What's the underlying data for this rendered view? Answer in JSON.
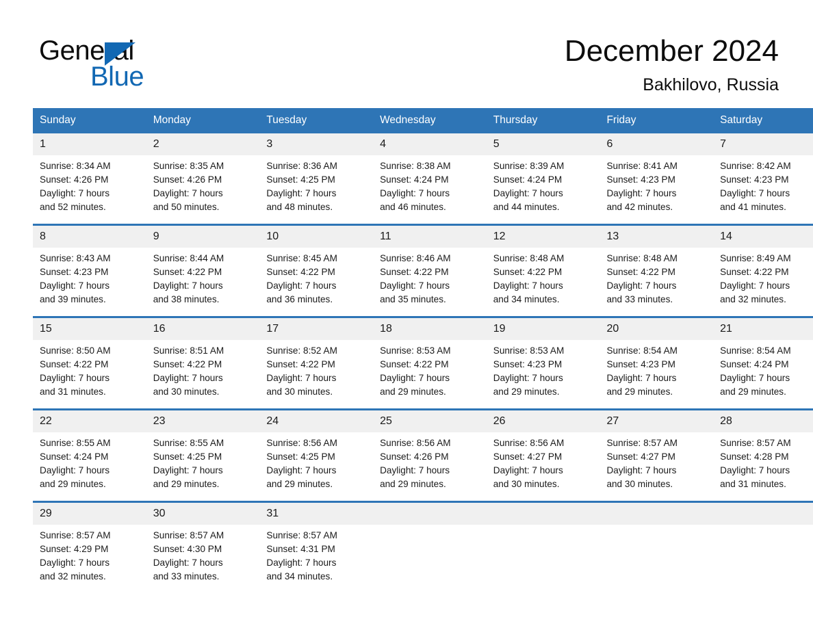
{
  "brand": {
    "name_part1": "General",
    "name_part2": "Blue",
    "accent_color": "#1268b3",
    "triangle_icon": "triangle-icon"
  },
  "header": {
    "month_title": "December 2024",
    "location": "Bakhilovo, Russia"
  },
  "theme": {
    "header_blue": "#2e75b6",
    "row_gray": "#f0f0f0",
    "text_black": "#1a1a1a"
  },
  "calendar": {
    "weekday_headers": [
      "Sunday",
      "Monday",
      "Tuesday",
      "Wednesday",
      "Thursday",
      "Friday",
      "Saturday"
    ],
    "weeks": [
      [
        {
          "day": "1",
          "sunrise": "Sunrise: 8:34 AM",
          "sunset": "Sunset: 4:26 PM",
          "daylight_line1": "Daylight: 7 hours",
          "daylight_line2": "and 52 minutes."
        },
        {
          "day": "2",
          "sunrise": "Sunrise: 8:35 AM",
          "sunset": "Sunset: 4:26 PM",
          "daylight_line1": "Daylight: 7 hours",
          "daylight_line2": "and 50 minutes."
        },
        {
          "day": "3",
          "sunrise": "Sunrise: 8:36 AM",
          "sunset": "Sunset: 4:25 PM",
          "daylight_line1": "Daylight: 7 hours",
          "daylight_line2": "and 48 minutes."
        },
        {
          "day": "4",
          "sunrise": "Sunrise: 8:38 AM",
          "sunset": "Sunset: 4:24 PM",
          "daylight_line1": "Daylight: 7 hours",
          "daylight_line2": "and 46 minutes."
        },
        {
          "day": "5",
          "sunrise": "Sunrise: 8:39 AM",
          "sunset": "Sunset: 4:24 PM",
          "daylight_line1": "Daylight: 7 hours",
          "daylight_line2": "and 44 minutes."
        },
        {
          "day": "6",
          "sunrise": "Sunrise: 8:41 AM",
          "sunset": "Sunset: 4:23 PM",
          "daylight_line1": "Daylight: 7 hours",
          "daylight_line2": "and 42 minutes."
        },
        {
          "day": "7",
          "sunrise": "Sunrise: 8:42 AM",
          "sunset": "Sunset: 4:23 PM",
          "daylight_line1": "Daylight: 7 hours",
          "daylight_line2": "and 41 minutes."
        }
      ],
      [
        {
          "day": "8",
          "sunrise": "Sunrise: 8:43 AM",
          "sunset": "Sunset: 4:23 PM",
          "daylight_line1": "Daylight: 7 hours",
          "daylight_line2": "and 39 minutes."
        },
        {
          "day": "9",
          "sunrise": "Sunrise: 8:44 AM",
          "sunset": "Sunset: 4:22 PM",
          "daylight_line1": "Daylight: 7 hours",
          "daylight_line2": "and 38 minutes."
        },
        {
          "day": "10",
          "sunrise": "Sunrise: 8:45 AM",
          "sunset": "Sunset: 4:22 PM",
          "daylight_line1": "Daylight: 7 hours",
          "daylight_line2": "and 36 minutes."
        },
        {
          "day": "11",
          "sunrise": "Sunrise: 8:46 AM",
          "sunset": "Sunset: 4:22 PM",
          "daylight_line1": "Daylight: 7 hours",
          "daylight_line2": "and 35 minutes."
        },
        {
          "day": "12",
          "sunrise": "Sunrise: 8:48 AM",
          "sunset": "Sunset: 4:22 PM",
          "daylight_line1": "Daylight: 7 hours",
          "daylight_line2": "and 34 minutes."
        },
        {
          "day": "13",
          "sunrise": "Sunrise: 8:48 AM",
          "sunset": "Sunset: 4:22 PM",
          "daylight_line1": "Daylight: 7 hours",
          "daylight_line2": "and 33 minutes."
        },
        {
          "day": "14",
          "sunrise": "Sunrise: 8:49 AM",
          "sunset": "Sunset: 4:22 PM",
          "daylight_line1": "Daylight: 7 hours",
          "daylight_line2": "and 32 minutes."
        }
      ],
      [
        {
          "day": "15",
          "sunrise": "Sunrise: 8:50 AM",
          "sunset": "Sunset: 4:22 PM",
          "daylight_line1": "Daylight: 7 hours",
          "daylight_line2": "and 31 minutes."
        },
        {
          "day": "16",
          "sunrise": "Sunrise: 8:51 AM",
          "sunset": "Sunset: 4:22 PM",
          "daylight_line1": "Daylight: 7 hours",
          "daylight_line2": "and 30 minutes."
        },
        {
          "day": "17",
          "sunrise": "Sunrise: 8:52 AM",
          "sunset": "Sunset: 4:22 PM",
          "daylight_line1": "Daylight: 7 hours",
          "daylight_line2": "and 30 minutes."
        },
        {
          "day": "18",
          "sunrise": "Sunrise: 8:53 AM",
          "sunset": "Sunset: 4:22 PM",
          "daylight_line1": "Daylight: 7 hours",
          "daylight_line2": "and 29 minutes."
        },
        {
          "day": "19",
          "sunrise": "Sunrise: 8:53 AM",
          "sunset": "Sunset: 4:23 PM",
          "daylight_line1": "Daylight: 7 hours",
          "daylight_line2": "and 29 minutes."
        },
        {
          "day": "20",
          "sunrise": "Sunrise: 8:54 AM",
          "sunset": "Sunset: 4:23 PM",
          "daylight_line1": "Daylight: 7 hours",
          "daylight_line2": "and 29 minutes."
        },
        {
          "day": "21",
          "sunrise": "Sunrise: 8:54 AM",
          "sunset": "Sunset: 4:24 PM",
          "daylight_line1": "Daylight: 7 hours",
          "daylight_line2": "and 29 minutes."
        }
      ],
      [
        {
          "day": "22",
          "sunrise": "Sunrise: 8:55 AM",
          "sunset": "Sunset: 4:24 PM",
          "daylight_line1": "Daylight: 7 hours",
          "daylight_line2": "and 29 minutes."
        },
        {
          "day": "23",
          "sunrise": "Sunrise: 8:55 AM",
          "sunset": "Sunset: 4:25 PM",
          "daylight_line1": "Daylight: 7 hours",
          "daylight_line2": "and 29 minutes."
        },
        {
          "day": "24",
          "sunrise": "Sunrise: 8:56 AM",
          "sunset": "Sunset: 4:25 PM",
          "daylight_line1": "Daylight: 7 hours",
          "daylight_line2": "and 29 minutes."
        },
        {
          "day": "25",
          "sunrise": "Sunrise: 8:56 AM",
          "sunset": "Sunset: 4:26 PM",
          "daylight_line1": "Daylight: 7 hours",
          "daylight_line2": "and 29 minutes."
        },
        {
          "day": "26",
          "sunrise": "Sunrise: 8:56 AM",
          "sunset": "Sunset: 4:27 PM",
          "daylight_line1": "Daylight: 7 hours",
          "daylight_line2": "and 30 minutes."
        },
        {
          "day": "27",
          "sunrise": "Sunrise: 8:57 AM",
          "sunset": "Sunset: 4:27 PM",
          "daylight_line1": "Daylight: 7 hours",
          "daylight_line2": "and 30 minutes."
        },
        {
          "day": "28",
          "sunrise": "Sunrise: 8:57 AM",
          "sunset": "Sunset: 4:28 PM",
          "daylight_line1": "Daylight: 7 hours",
          "daylight_line2": "and 31 minutes."
        }
      ],
      [
        {
          "day": "29",
          "sunrise": "Sunrise: 8:57 AM",
          "sunset": "Sunset: 4:29 PM",
          "daylight_line1": "Daylight: 7 hours",
          "daylight_line2": "and 32 minutes."
        },
        {
          "day": "30",
          "sunrise": "Sunrise: 8:57 AM",
          "sunset": "Sunset: 4:30 PM",
          "daylight_line1": "Daylight: 7 hours",
          "daylight_line2": "and 33 minutes."
        },
        {
          "day": "31",
          "sunrise": "Sunrise: 8:57 AM",
          "sunset": "Sunset: 4:31 PM",
          "daylight_line1": "Daylight: 7 hours",
          "daylight_line2": "and 34 minutes."
        },
        {
          "day": "",
          "sunrise": "",
          "sunset": "",
          "daylight_line1": "",
          "daylight_line2": ""
        },
        {
          "day": "",
          "sunrise": "",
          "sunset": "",
          "daylight_line1": "",
          "daylight_line2": ""
        },
        {
          "day": "",
          "sunrise": "",
          "sunset": "",
          "daylight_line1": "",
          "daylight_line2": ""
        },
        {
          "day": "",
          "sunrise": "",
          "sunset": "",
          "daylight_line1": "",
          "daylight_line2": ""
        }
      ]
    ]
  }
}
